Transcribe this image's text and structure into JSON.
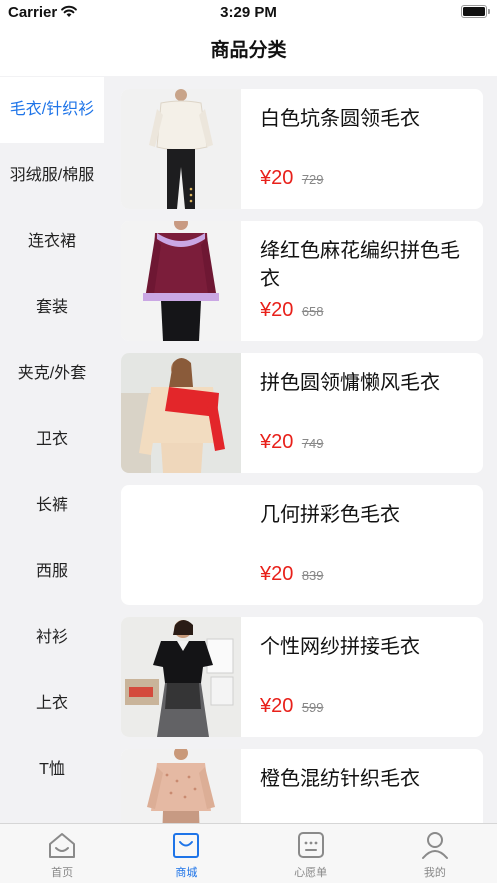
{
  "status_bar": {
    "carrier": "Carrier",
    "time": "3:29 PM"
  },
  "nav": {
    "title": "商品分类"
  },
  "categories": [
    {
      "label": "毛衣/针织衫",
      "active": true
    },
    {
      "label": "羽绒服/棉服",
      "active": false
    },
    {
      "label": "连衣裙",
      "active": false
    },
    {
      "label": "套装",
      "active": false
    },
    {
      "label": "夹克/外套",
      "active": false
    },
    {
      "label": "卫衣",
      "active": false
    },
    {
      "label": "长裤",
      "active": false
    },
    {
      "label": "西服",
      "active": false
    },
    {
      "label": "衬衫",
      "active": false
    },
    {
      "label": "上衣",
      "active": false
    },
    {
      "label": "T恤",
      "active": false
    }
  ],
  "products": [
    {
      "name": "白色坑条圆领毛衣",
      "price": "¥20",
      "original_price": "729",
      "image": "sweater-white-photo"
    },
    {
      "name": "绛红色麻花编织拼色毛衣",
      "price": "¥20",
      "original_price": "658",
      "image": "sweater-maroon-photo"
    },
    {
      "name": "拼色圆领慵懒风毛衣",
      "price": "¥20",
      "original_price": "749",
      "image": "sweater-colorblock-photo"
    },
    {
      "name": "几何拼彩色毛衣",
      "price": "¥20",
      "original_price": "839",
      "image": ""
    },
    {
      "name": "个性网纱拼接毛衣",
      "price": "¥20",
      "original_price": "599",
      "image": "sweater-mesh-photo"
    },
    {
      "name": "橙色混纺针织毛衣",
      "price": "",
      "original_price": "",
      "image": "sweater-orange-photo"
    }
  ],
  "tabs": [
    {
      "label": "首页",
      "icon": "home-icon",
      "active": false
    },
    {
      "label": "商城",
      "icon": "shop-bag-icon",
      "active": true
    },
    {
      "label": "心愿单",
      "icon": "wishlist-icon",
      "active": false
    },
    {
      "label": "我的",
      "icon": "profile-icon",
      "active": false
    }
  ],
  "colors": {
    "accent": "#1e74e8",
    "price": "#e8201a"
  }
}
